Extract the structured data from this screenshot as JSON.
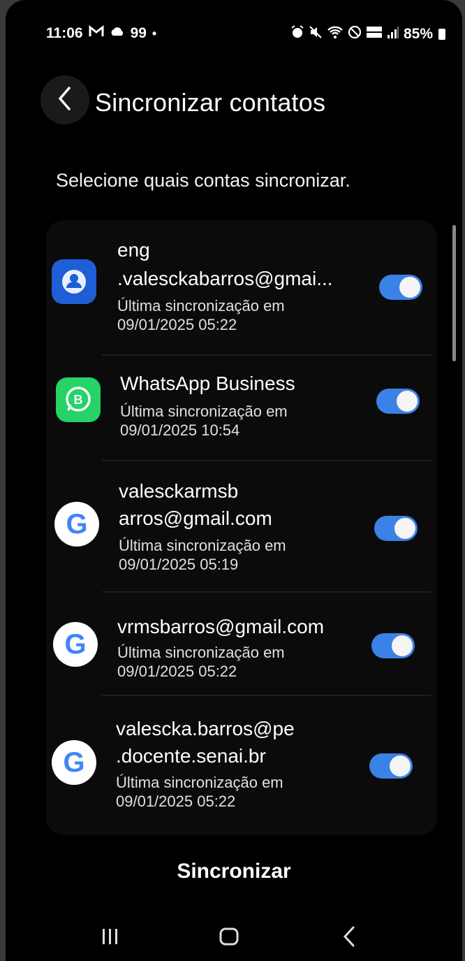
{
  "status_bar": {
    "time": "11:06",
    "left_icons": [
      "gmail-icon",
      "cloud-icon"
    ],
    "notification_count": "99",
    "battery": "85%"
  },
  "header": {
    "title": "Sincronizar contatos"
  },
  "subtitle": "Selecione quais contas sincronizar.",
  "accounts": [
    {
      "name_line1": "eng",
      "name_line2": ".valesckabarros@gmai...",
      "sync_label": "Última sincronização em",
      "sync_time": "09/01/2025 05:22",
      "icon": "samsung-account-icon",
      "enabled": true
    },
    {
      "name_line1": "WhatsApp Business",
      "sync_label": "Última sincronização em",
      "sync_time": "09/01/2025 10:54",
      "icon": "whatsapp-business-icon",
      "enabled": true
    },
    {
      "name_line1": "valesckarmsb",
      "name_line2": "arros@gmail.com",
      "sync_label": "Última sincronização em",
      "sync_time": "09/01/2025 05:19",
      "icon": "google-icon",
      "enabled": true
    },
    {
      "name_line1": "vrmsbarros@gmail.com",
      "sync_label": "Última sincronização em",
      "sync_time": "09/01/2025 05:22",
      "icon": "google-icon",
      "enabled": true
    },
    {
      "name_line1": "valescka.barros@pe",
      "name_line2": ".docente.senai.br",
      "sync_label": "Última sincronização em",
      "sync_time": "09/01/2025 05:22",
      "icon": "google-icon",
      "enabled": true
    }
  ],
  "sync_button": "Sincronizar",
  "colors": {
    "toggle_on": "#3b82e6",
    "background": "#000000",
    "whatsapp_green": "#25d366",
    "samsung_blue": "#1f5fd6"
  }
}
